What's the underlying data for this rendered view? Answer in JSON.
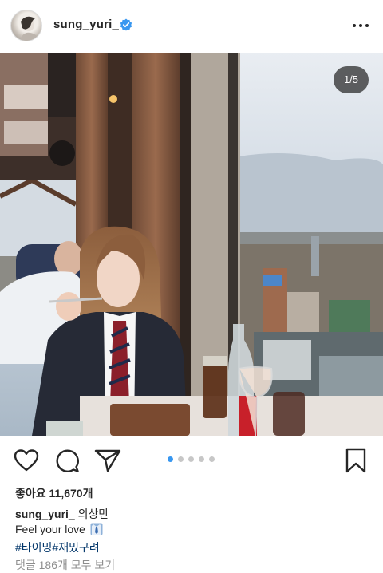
{
  "post": {
    "username": "sung_yuri_",
    "carousel_counter": "1/5",
    "carousel_total": 5,
    "carousel_active_index": 0,
    "likes_text": "좋아요 11,670개",
    "caption_user": "sung_yuri_",
    "caption_text": "의상만",
    "caption_line2": "Feel your love",
    "hashtags": "#타이밍#재밌구려",
    "comments_link": "댓글 186개 모두 보기"
  },
  "icons": {
    "more": "more-options-icon",
    "verified": "verified-badge-icon",
    "like": "heart-icon",
    "comment": "comment-bubble-icon",
    "share": "paper-plane-icon",
    "save": "bookmark-icon",
    "emoji": "necktie-shirt-emoji"
  },
  "colors": {
    "verified_blue": "#3897f0",
    "hashtag_blue": "#003569",
    "muted_gray": "#8e8e8e",
    "carousel_active": "#3897f0",
    "carousel_inactive": "#c7c7c7"
  }
}
